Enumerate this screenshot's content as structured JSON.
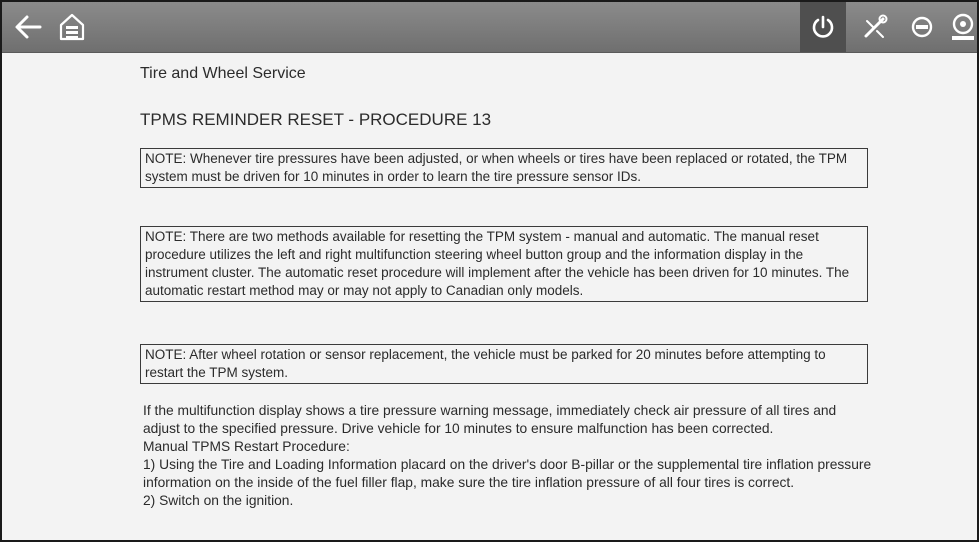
{
  "toolbar": {
    "icons": [
      "back-arrow-icon",
      "home-icon",
      "power-icon",
      "tool-icon",
      "gauge-icon",
      "steering-wheel-icon"
    ]
  },
  "content": {
    "section_title": "Tire and Wheel Service",
    "procedure_title": "TPMS REMINDER RESET - PROCEDURE 13",
    "notes": [
      "NOTE: Whenever tire pressures have been adjusted, or when wheels or tires have been replaced or rotated, the TPM system must be driven for 10 minutes in order to learn the tire pressure sensor IDs.",
      "NOTE: There are two methods available for resetting the TPM system - manual and automatic. The manual reset procedure utilizes the left and right multifunction steering wheel button group and the information display in the instrument cluster. The automatic reset procedure will implement after the vehicle has been driven for 10 minutes. The automatic restart method may or may not apply to Canadian only models.",
      "NOTE: After wheel rotation or sensor replacement, the vehicle must be parked for 20 minutes before attempting to restart the TPM system."
    ],
    "paragraphs": [
      "If the multifunction display shows a tire pressure warning message, immediately check air pressure of all tires and adjust to the specified pressure. Drive vehicle for 10 minutes to ensure malfunction has been corrected.",
      "Manual TPMS Restart Procedure:",
      "1) Using the Tire and Loading Information placard on the driver's door B-pillar or the supplemental tire inflation pressure information on the inside of the fuel filler flap, make sure the tire inflation pressure of all four tires is correct.",
      "2) Switch on the ignition."
    ]
  },
  "colors": {
    "toolbar": "#7d7d7d",
    "active_button": "#4f4f4f",
    "content_bg": "#f3f3f3",
    "text": "#2b2b2b"
  }
}
